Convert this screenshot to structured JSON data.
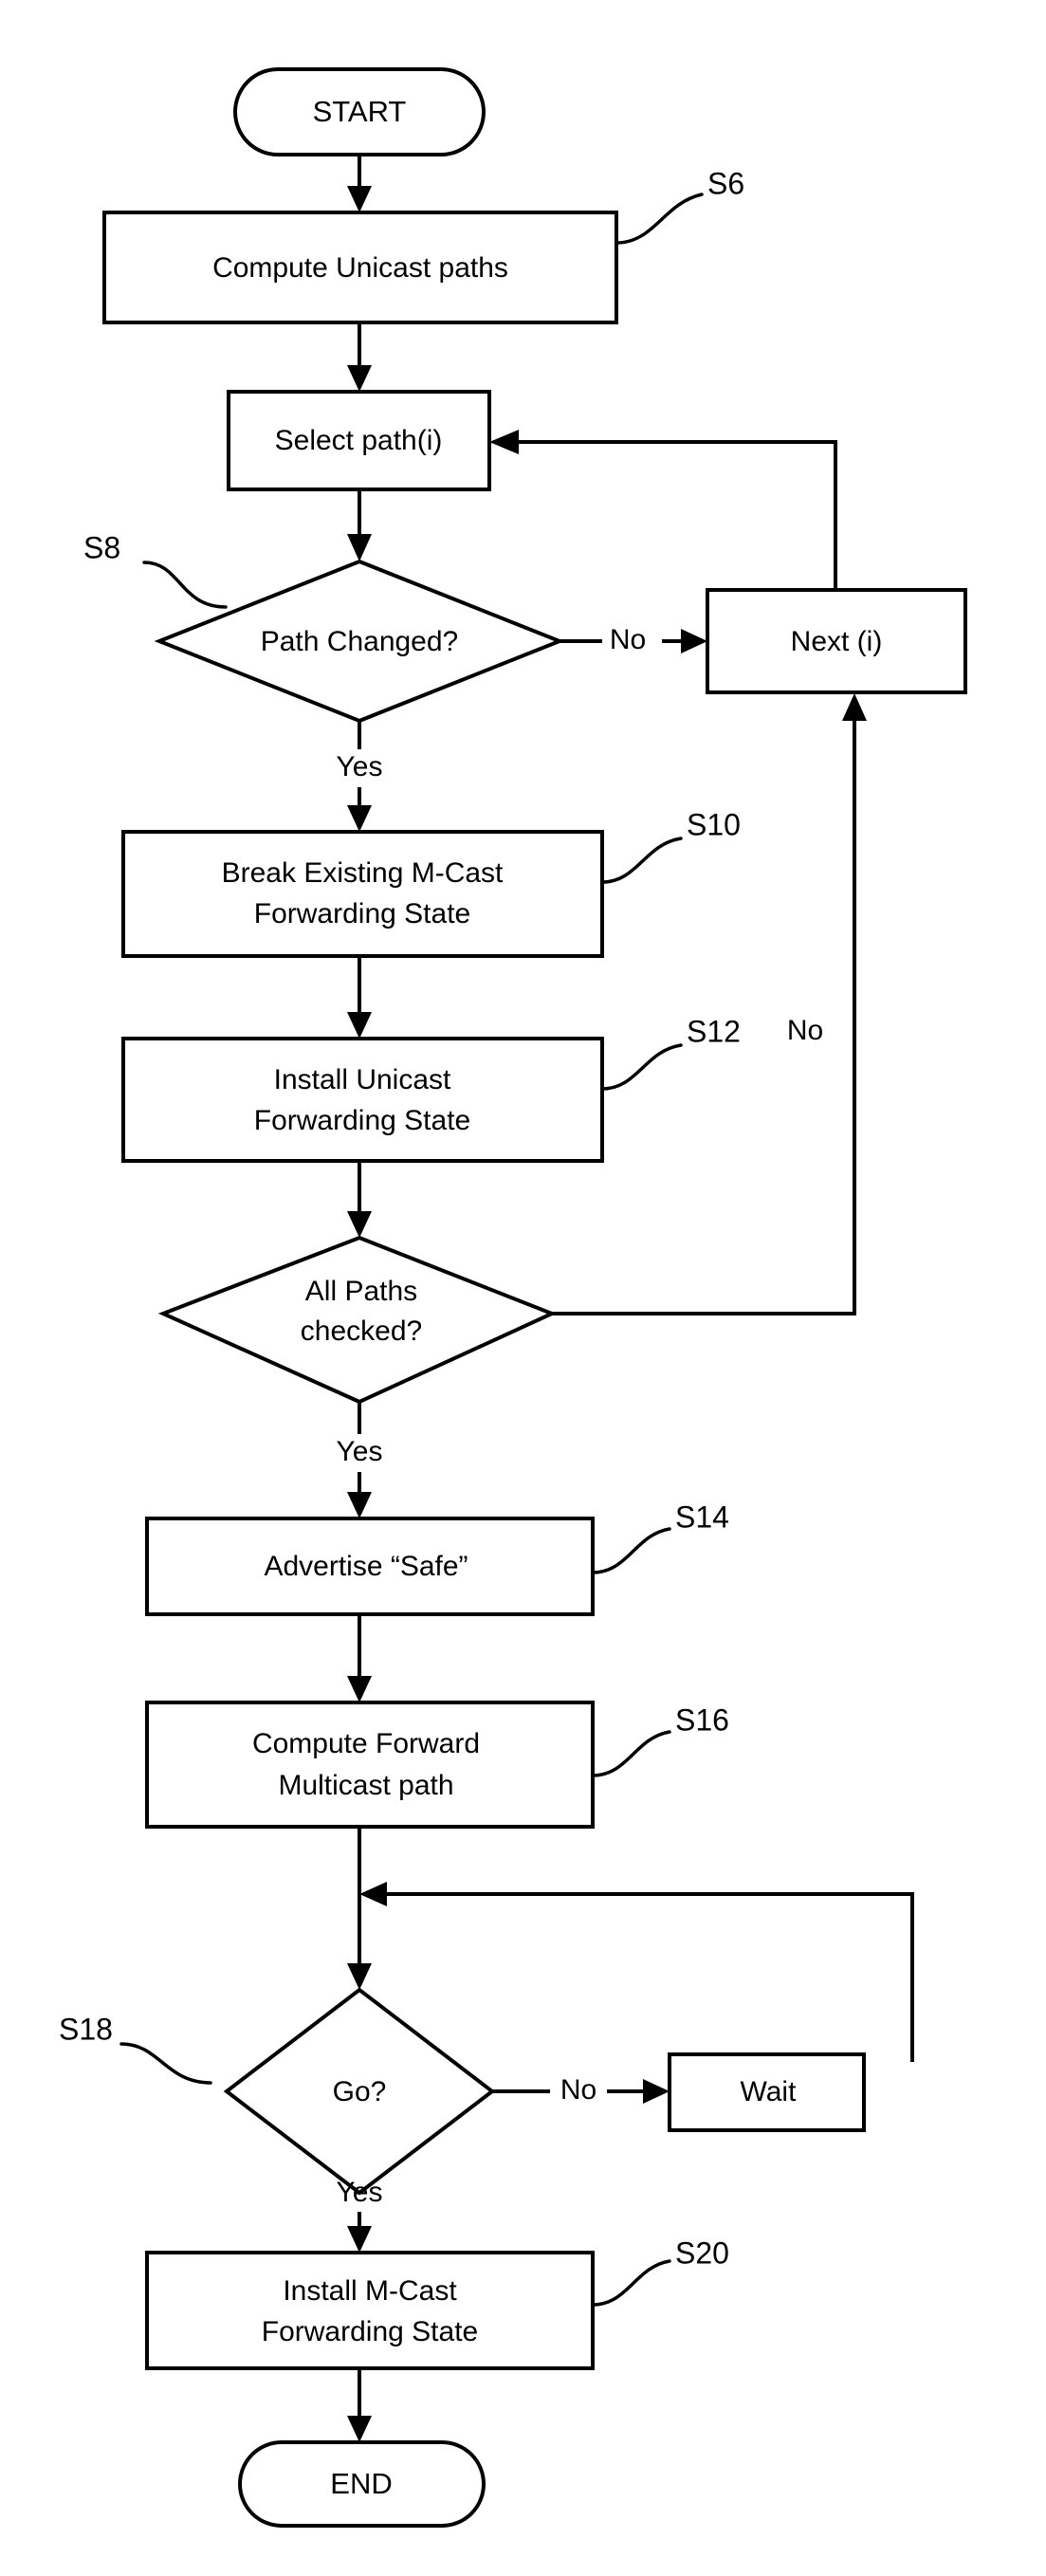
{
  "diagram": {
    "type": "flowchart",
    "title": "Unicast / Multicast Forwarding State Update Flowchart",
    "background_color": "#ffffff",
    "line_color": "#000000",
    "nodes": [
      {
        "id": "start",
        "shape": "terminator",
        "label": "START"
      },
      {
        "id": "s6",
        "shape": "process",
        "label": "Compute Unicast paths"
      },
      {
        "id": "select",
        "shape": "process",
        "label": "Select path(i)"
      },
      {
        "id": "s8",
        "shape": "decision",
        "label": "Path Changed?"
      },
      {
        "id": "next",
        "shape": "process",
        "label": "Next (i)"
      },
      {
        "id": "s10",
        "shape": "process",
        "label_line1": "Break Existing  M-Cast",
        "label_line2": "Forwarding State"
      },
      {
        "id": "s12",
        "shape": "process",
        "label_line1": "Install Unicast",
        "label_line2": "Forwarding State"
      },
      {
        "id": "allpaths",
        "shape": "decision",
        "label_line1": "All Paths",
        "label_line2": "checked?"
      },
      {
        "id": "s14",
        "shape": "process",
        "label": "Advertise “Safe”"
      },
      {
        "id": "s16",
        "shape": "process",
        "label_line1": "Compute Forward",
        "label_line2": "Multicast path"
      },
      {
        "id": "s18",
        "shape": "decision",
        "label": "Go?"
      },
      {
        "id": "wait",
        "shape": "process",
        "label": "Wait"
      },
      {
        "id": "s20",
        "shape": "process",
        "label_line1": "Install M-Cast",
        "label_line2": "Forwarding State"
      },
      {
        "id": "end",
        "shape": "terminator",
        "label": "END"
      }
    ],
    "step_labels": [
      {
        "id": "S6",
        "text": "S6",
        "attached_to": "s6"
      },
      {
        "id": "S8",
        "text": "S8",
        "attached_to": "s8"
      },
      {
        "id": "S10",
        "text": "S10",
        "attached_to": "s10"
      },
      {
        "id": "S12",
        "text": "S12",
        "attached_to": "s12"
      },
      {
        "id": "S14",
        "text": "S14",
        "attached_to": "s14"
      },
      {
        "id": "S16",
        "text": "S16",
        "attached_to": "s16"
      },
      {
        "id": "S18",
        "text": "S18",
        "attached_to": "s18"
      },
      {
        "id": "S20",
        "text": "S20",
        "attached_to": "s20"
      }
    ],
    "edge_labels": [
      {
        "id": "e1",
        "text": "No",
        "from": "s8",
        "to": "next"
      },
      {
        "id": "e2",
        "text": "Yes",
        "from": "s8",
        "to": "s10"
      },
      {
        "id": "e3",
        "text": "No",
        "from": "allpaths",
        "to": "next"
      },
      {
        "id": "e4",
        "text": "Yes",
        "from": "allpaths",
        "to": "s14"
      },
      {
        "id": "e5",
        "text": "No",
        "from": "s18",
        "to": "wait"
      },
      {
        "id": "e6",
        "text": "Yes",
        "from": "s18",
        "to": "s20"
      }
    ],
    "edges": [
      {
        "from": "start",
        "to": "s6",
        "label": ""
      },
      {
        "from": "s6",
        "to": "select",
        "label": ""
      },
      {
        "from": "select",
        "to": "s8",
        "label": ""
      },
      {
        "from": "s8",
        "to": "next",
        "label": "No"
      },
      {
        "from": "s8",
        "to": "s10",
        "label": "Yes"
      },
      {
        "from": "s10",
        "to": "s12",
        "label": ""
      },
      {
        "from": "s12",
        "to": "allpaths",
        "label": ""
      },
      {
        "from": "allpaths",
        "to": "next",
        "label": "No"
      },
      {
        "from": "allpaths",
        "to": "s14",
        "label": "Yes"
      },
      {
        "from": "next",
        "to": "select",
        "label": ""
      },
      {
        "from": "s14",
        "to": "s16",
        "label": ""
      },
      {
        "from": "s16",
        "to": "s18",
        "label": ""
      },
      {
        "from": "s18",
        "to": "wait",
        "label": "No"
      },
      {
        "from": "s18",
        "to": "s20",
        "label": "Yes"
      },
      {
        "from": "wait",
        "to": "s18",
        "label": ""
      },
      {
        "from": "s20",
        "to": "end",
        "label": ""
      }
    ]
  }
}
